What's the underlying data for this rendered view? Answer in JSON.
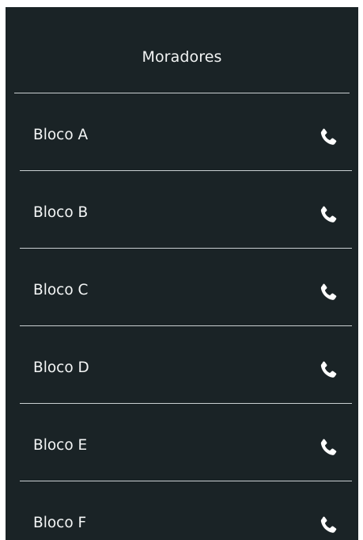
{
  "header": {
    "title": "Moradores"
  },
  "blocks": [
    {
      "label": "Bloco A",
      "icon": "phone-icon"
    },
    {
      "label": "Bloco B",
      "icon": "phone-icon"
    },
    {
      "label": "Bloco C",
      "icon": "phone-icon"
    },
    {
      "label": "Bloco D",
      "icon": "phone-icon"
    },
    {
      "label": "Bloco E",
      "icon": "phone-icon"
    },
    {
      "label": "Bloco F",
      "icon": "phone-icon"
    }
  ],
  "colors": {
    "background": "#1a2326",
    "text": "#ffffff",
    "divider": "#c9cfd1"
  }
}
